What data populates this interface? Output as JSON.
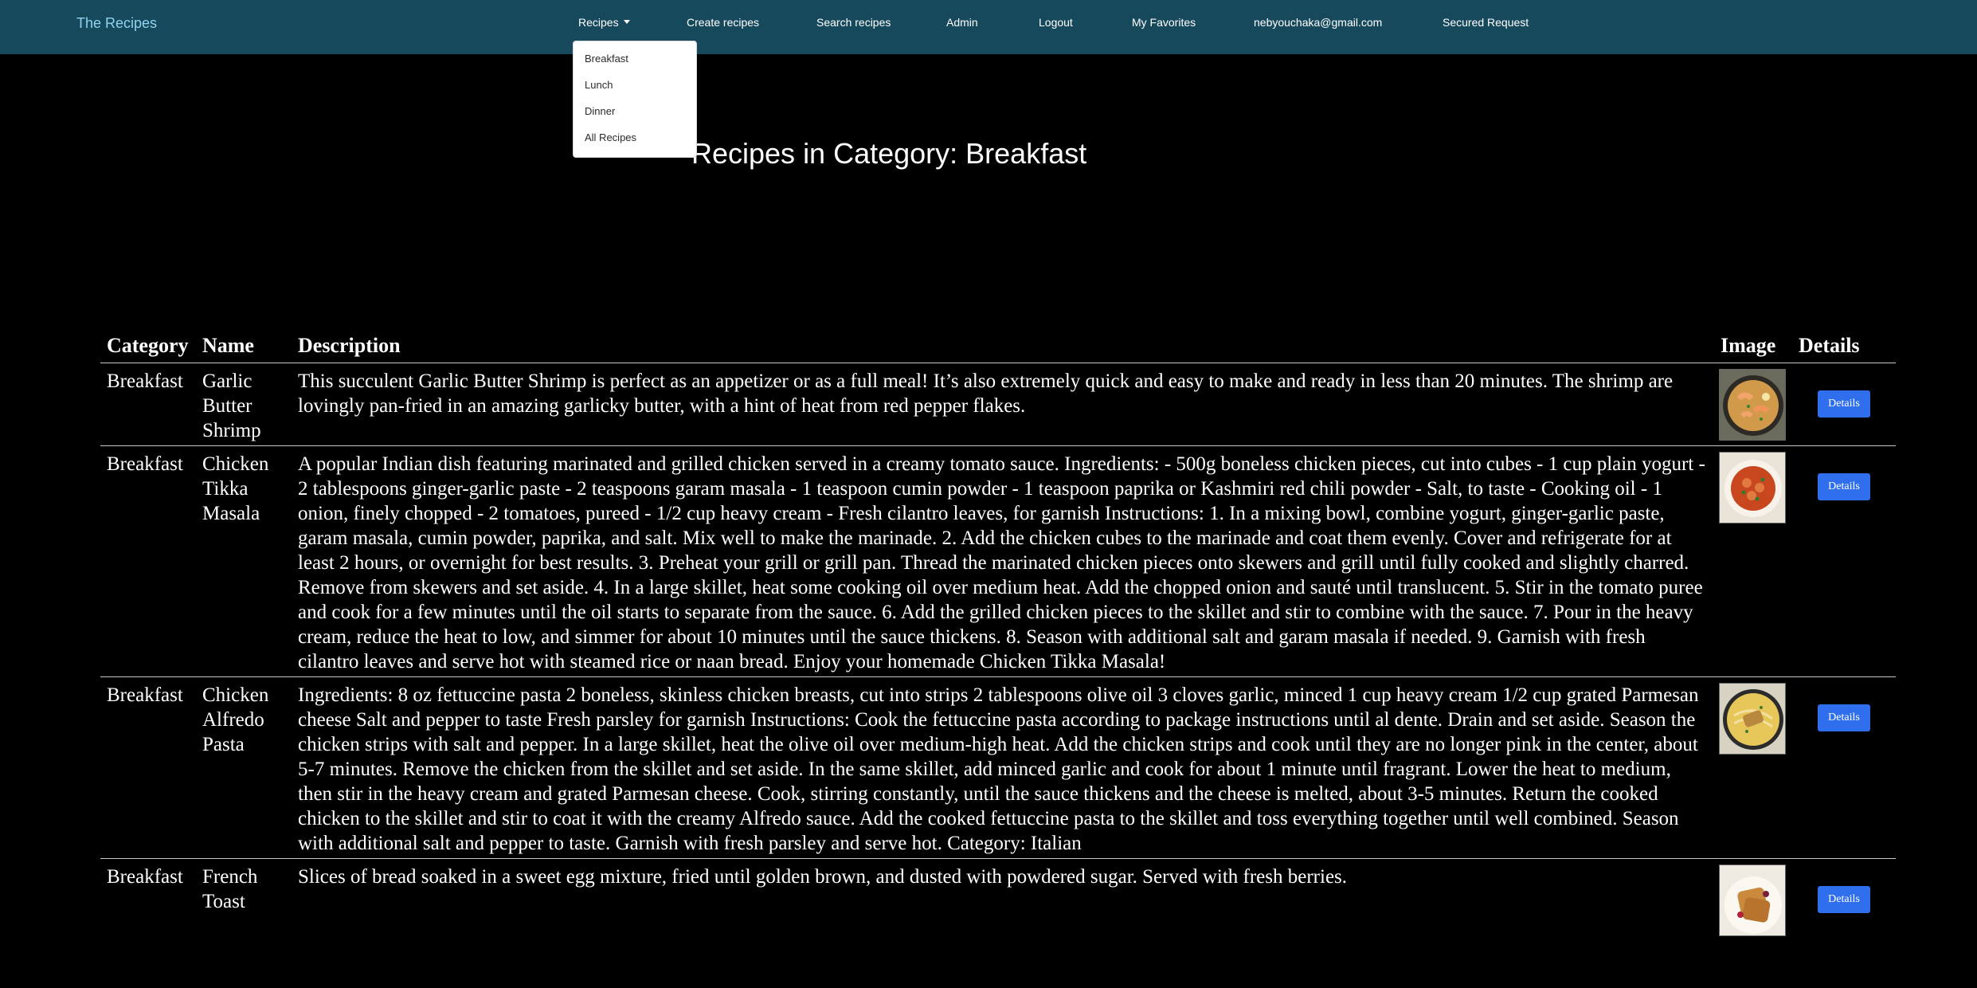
{
  "navbar": {
    "brand": "The Recipes",
    "items": [
      {
        "label": "Recipes"
      },
      {
        "label": "Create recipes"
      },
      {
        "label": "Search recipes"
      },
      {
        "label": "Admin"
      },
      {
        "label": "Logout"
      },
      {
        "label": "My Favorites"
      },
      {
        "label": "nebyouchaka@gmail.com"
      },
      {
        "label": "Secured Request"
      }
    ]
  },
  "dropdown": {
    "items": [
      {
        "label": "Breakfast"
      },
      {
        "label": "Lunch"
      },
      {
        "label": "Dinner"
      },
      {
        "label": "All Recipes"
      }
    ]
  },
  "page": {
    "title": "Recipes in Category: Breakfast"
  },
  "table": {
    "headers": [
      "Category",
      "Name",
      "Description",
      "Image",
      "Details"
    ],
    "details_label": "Details",
    "rows": [
      {
        "category": "Breakfast",
        "name": "Garlic Butter Shrimp",
        "description": "This succulent Garlic Butter Shrimp is perfect as an appetizer or as a full meal! It’s also extremely quick and easy to make and ready in less than 20 minutes. The shrimp are lovingly pan-fried in an amazing garlicky butter, with a hint of heat from red pepper flakes.",
        "image_icon": "shrimp-pan-photo"
      },
      {
        "category": "Breakfast",
        "name": "Chicken Tikka Masala",
        "description": "A popular Indian dish featuring marinated and grilled chicken served in a creamy tomato sauce. Ingredients: - 500g boneless chicken pieces, cut into cubes - 1 cup plain yogurt - 2 tablespoons ginger-garlic paste - 2 teaspoons garam masala - 1 teaspoon cumin powder - 1 teaspoon paprika or Kashmiri red chili powder - Salt, to taste - Cooking oil - 1 onion, finely chopped - 2 tomatoes, pureed - 1/2 cup heavy cream - Fresh cilantro leaves, for garnish Instructions: 1. In a mixing bowl, combine yogurt, ginger-garlic paste, garam masala, cumin powder, paprika, and salt. Mix well to make the marinade. 2. Add the chicken cubes to the marinade and coat them evenly. Cover and refrigerate for at least 2 hours, or overnight for best results. 3. Preheat your grill or grill pan. Thread the marinated chicken pieces onto skewers and grill until fully cooked and slightly charred. Remove from skewers and set aside. 4. In a large skillet, heat some cooking oil over medium heat. Add the chopped onion and sauté until translucent. 5. Stir in the tomato puree and cook for a few minutes until the oil starts to separate from the sauce. 6. Add the grilled chicken pieces to the skillet and stir to combine with the sauce. 7. Pour in the heavy cream, reduce the heat to low, and simmer for about 10 minutes until the sauce thickens. 8. Season with additional salt and garam masala if needed. 9. Garnish with fresh cilantro leaves and serve hot with steamed rice or naan bread. Enjoy your homemade Chicken Tikka Masala!",
        "image_icon": "tikka-masala-photo"
      },
      {
        "category": "Breakfast",
        "name": "Chicken Alfredo Pasta",
        "description": "Ingredients: 8 oz fettuccine pasta 2 boneless, skinless chicken breasts, cut into strips 2 tablespoons olive oil 3 cloves garlic, minced 1 cup heavy cream 1/2 cup grated Parmesan cheese Salt and pepper to taste Fresh parsley for garnish Instructions: Cook the fettuccine pasta according to package instructions until al dente. Drain and set aside. Season the chicken strips with salt and pepper. In a large skillet, heat the olive oil over medium-high heat. Add the chicken strips and cook until they are no longer pink in the center, about 5-7 minutes. Remove the chicken from the skillet and set aside. In the same skillet, add minced garlic and cook for about 1 minute until fragrant. Lower the heat to medium, then stir in the heavy cream and grated Parmesan cheese. Cook, stirring constantly, until the sauce thickens and the cheese is melted, about 3-5 minutes. Return the cooked chicken to the skillet and stir to coat it with the creamy Alfredo sauce. Add the cooked fettuccine pasta to the skillet and toss everything together until well combined. Season with additional salt and pepper to taste. Garnish with fresh parsley and serve hot. Category: Italian",
        "image_icon": "alfredo-pasta-photo"
      },
      {
        "category": "Breakfast",
        "name": "French Toast",
        "description": "Slices of bread soaked in a sweet egg mixture, fried until golden brown, and dusted with powdered sugar. Served with fresh berries.",
        "image_icon": "french-toast-photo"
      }
    ]
  }
}
